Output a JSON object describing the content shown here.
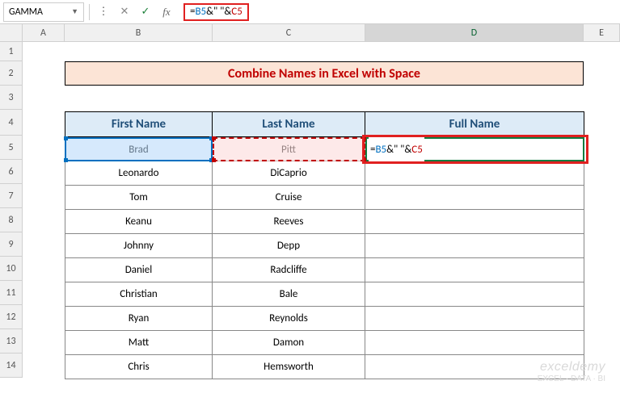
{
  "nameBox": "GAMMA",
  "formula": {
    "eq": "=",
    "ref1": "B5",
    "amp1": "&\" \"&",
    "ref2": "C5"
  },
  "columns": {
    "A": "A",
    "B": "B",
    "C": "C",
    "D": "D",
    "E": "E"
  },
  "rows": [
    "1",
    "2",
    "3",
    "4",
    "5",
    "6",
    "7",
    "8",
    "9",
    "10",
    "11",
    "12",
    "13",
    "14"
  ],
  "title": "Combine Names in Excel with Space",
  "headers": {
    "first": "First Name",
    "last": "Last Name",
    "full": "Full Name"
  },
  "data": [
    {
      "first": "Brad",
      "last": "Pitt"
    },
    {
      "first": "Leonardo",
      "last": "DiCaprio"
    },
    {
      "first": "Tom",
      "last": "Cruise"
    },
    {
      "first": "Keanu",
      "last": "Reeves"
    },
    {
      "first": "Johnny",
      "last": "Depp"
    },
    {
      "first": "Daniel",
      "last": "Radcliffe"
    },
    {
      "first": "Christian",
      "last": "Bale"
    },
    {
      "first": "Ryan",
      "last": "Reynolds"
    },
    {
      "first": "Matt",
      "last": "Damon"
    },
    {
      "first": "Chris",
      "last": "Hemsworth"
    }
  ],
  "watermark": {
    "brand": "exceldemy",
    "tag": "EXCEL · DATA · BI"
  },
  "chart_data": {
    "type": "table",
    "title": "Combine Names in Excel with Space",
    "columns": [
      "First Name",
      "Last Name",
      "Full Name"
    ],
    "rows": [
      [
        "Brad",
        "Pitt",
        "=B5&\" \"&C5"
      ],
      [
        "Leonardo",
        "DiCaprio",
        ""
      ],
      [
        "Tom",
        "Cruise",
        ""
      ],
      [
        "Keanu",
        "Reeves",
        ""
      ],
      [
        "Johnny",
        "Depp",
        ""
      ],
      [
        "Daniel",
        "Radcliffe",
        ""
      ],
      [
        "Christian",
        "Bale",
        ""
      ],
      [
        "Ryan",
        "Reynolds",
        ""
      ],
      [
        "Matt",
        "Damon",
        ""
      ],
      [
        "Chris",
        "Hemsworth",
        ""
      ]
    ]
  }
}
